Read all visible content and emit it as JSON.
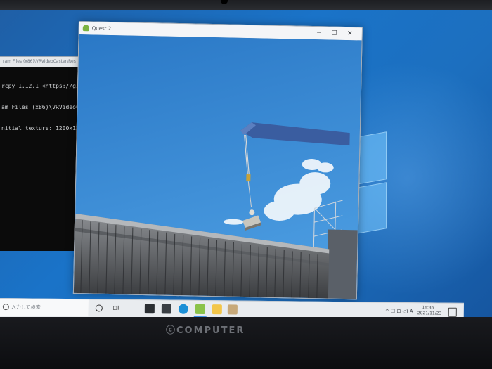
{
  "mirror_window": {
    "title": "Quest 2",
    "app_icon": "android-icon",
    "controls": {
      "minimize": "─",
      "maximize": "☐",
      "close": "✕"
    }
  },
  "console": {
    "title": "ram Files (x86)\\VRVideoCaster\\Res",
    "lines": [
      "rcpy 1.12.1 <https://githu",
      "am Files (x86)\\VRVideoCast",
      "nitial texture: 1200x1200"
    ]
  },
  "taskbar": {
    "search_text": "入力して検索",
    "task_view_label": "⊡I",
    "icons": [
      "cortana-icon",
      "task-view-icon",
      "store-icon",
      "mail-icon",
      "edge-icon",
      "android-icon",
      "explorer-icon",
      "quest-icon"
    ],
    "tray_text": "^ ☐ ⊡ ◁) A",
    "clock_time": "16:36",
    "clock_date": "2021/11/23"
  },
  "laptop": {
    "brand": "ⓒCOMPUTER"
  },
  "colors": {
    "desktop_blue": "#1a73c8",
    "sky": "#3b8fd8",
    "crane": "#3a5da0"
  }
}
